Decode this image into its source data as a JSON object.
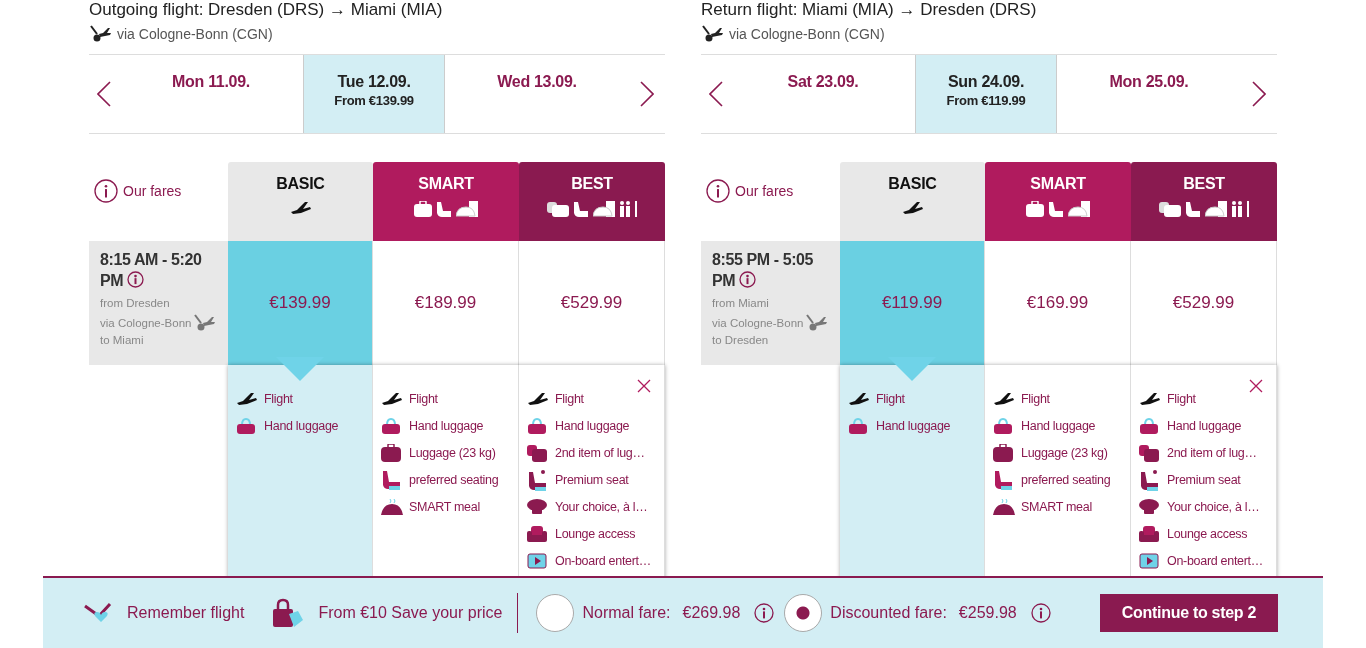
{
  "flights": [
    {
      "title": "Outgoing flight: Dresden (DRS) → Miami (MIA)",
      "via": "via Cologne-Bonn (CGN)",
      "dates": [
        {
          "day": "Mon 11.09.",
          "selected": false
        },
        {
          "day": "Tue 12.09.",
          "price": "From €139.99",
          "selected": true
        },
        {
          "day": "Wed 13.09.",
          "selected": false
        }
      ],
      "fares_label": "Our fares",
      "tiers": [
        {
          "name": "BASIC",
          "kind": "basic"
        },
        {
          "name": "SMART",
          "kind": "smart"
        },
        {
          "name": "BEST",
          "kind": "best"
        }
      ],
      "time": "8:15 AM - 5:20 PM",
      "from": "from Dresden",
      "stop": "via Cologne-Bonn",
      "to": "to Miami",
      "prices": [
        {
          "value": "€139.99",
          "selected": true
        },
        {
          "value": "€189.99",
          "selected": false
        },
        {
          "value": "€529.99",
          "selected": false
        }
      ],
      "features": [
        [
          {
            "kind": "plane",
            "text": "Flight"
          },
          {
            "kind": "handbag",
            "text": "Hand luggage"
          }
        ],
        [
          {
            "kind": "plane",
            "text": "Flight"
          },
          {
            "kind": "handbag",
            "text": "Hand luggage"
          },
          {
            "kind": "suitcase",
            "text": "Luggage (23 kg)"
          },
          {
            "kind": "seat",
            "text": "preferred seating"
          },
          {
            "kind": "meal",
            "text": "SMART meal"
          }
        ],
        [
          {
            "kind": "plane",
            "text": "Flight"
          },
          {
            "kind": "handbag",
            "text": "Hand luggage"
          },
          {
            "kind": "bags",
            "text": "2nd item of lug…"
          },
          {
            "kind": "premium",
            "text": "Premium seat"
          },
          {
            "kind": "chef",
            "text": "Your choice, à l…"
          },
          {
            "kind": "lounge",
            "text": "Lounge access"
          },
          {
            "kind": "screen",
            "text": "On-board entert…"
          }
        ]
      ]
    },
    {
      "title": "Return flight: Miami (MIA) → Dresden (DRS)",
      "via": "via Cologne-Bonn (CGN)",
      "dates": [
        {
          "day": "Sat 23.09.",
          "selected": false
        },
        {
          "day": "Sun 24.09.",
          "price": "From €119.99",
          "selected": true
        },
        {
          "day": "Mon 25.09.",
          "selected": false
        }
      ],
      "fares_label": "Our fares",
      "tiers": [
        {
          "name": "BASIC",
          "kind": "basic"
        },
        {
          "name": "SMART",
          "kind": "smart"
        },
        {
          "name": "BEST",
          "kind": "best"
        }
      ],
      "time": "8:55 PM - 5:05 PM",
      "from": "from Miami",
      "stop": "via Cologne-Bonn",
      "to": "to Dresden",
      "prices": [
        {
          "value": "€119.99",
          "selected": true
        },
        {
          "value": "€169.99",
          "selected": false
        },
        {
          "value": "€529.99",
          "selected": false
        }
      ],
      "features": [
        [
          {
            "kind": "plane",
            "text": "Flight"
          },
          {
            "kind": "handbag",
            "text": "Hand luggage"
          }
        ],
        [
          {
            "kind": "plane",
            "text": "Flight"
          },
          {
            "kind": "handbag",
            "text": "Hand luggage"
          },
          {
            "kind": "suitcase",
            "text": "Luggage (23 kg)"
          },
          {
            "kind": "seat",
            "text": "preferred seating"
          },
          {
            "kind": "meal",
            "text": "SMART meal"
          }
        ],
        [
          {
            "kind": "plane",
            "text": "Flight"
          },
          {
            "kind": "handbag",
            "text": "Hand luggage"
          },
          {
            "kind": "bags",
            "text": "2nd item of lug…"
          },
          {
            "kind": "premium",
            "text": "Premium seat"
          },
          {
            "kind": "chef",
            "text": "Your choice, à l…"
          },
          {
            "kind": "lounge",
            "text": "Lounge access"
          },
          {
            "kind": "screen",
            "text": "On-board entert…"
          }
        ]
      ]
    }
  ],
  "footer": {
    "remember": "Remember flight",
    "save": "From €10 Save your price",
    "options": [
      {
        "label": "Normal fare:",
        "price": "€269.98",
        "selected": false
      },
      {
        "label": "Discounted fare:",
        "price": "€259.98",
        "selected": true
      }
    ],
    "button": "Continue to step 2"
  }
}
